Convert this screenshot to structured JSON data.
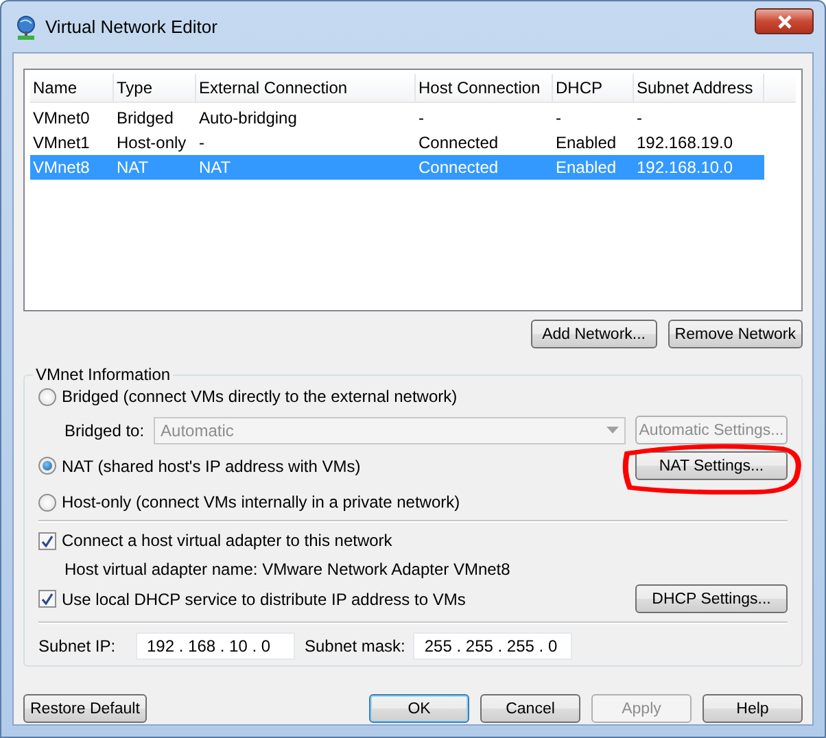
{
  "window": {
    "title": "Virtual Network Editor"
  },
  "table": {
    "columns": [
      "Name",
      "Type",
      "External Connection",
      "Host Connection",
      "DHCP",
      "Subnet Address"
    ],
    "rows": [
      {
        "cells": [
          "VMnet0",
          "Bridged",
          "Auto-bridging",
          "-",
          "-",
          "-"
        ],
        "selected": false
      },
      {
        "cells": [
          "VMnet1",
          "Host-only",
          "-",
          "Connected",
          "Enabled",
          "192.168.19.0"
        ],
        "selected": false
      },
      {
        "cells": [
          "VMnet8",
          "NAT",
          "NAT",
          "Connected",
          "Enabled",
          "192.168.10.0"
        ],
        "selected": true
      }
    ]
  },
  "table_buttons": [
    {
      "label": "Add Network..."
    },
    {
      "label": "Remove Network"
    }
  ],
  "vmnet_information": {
    "title": "VMnet Information",
    "bridged": {
      "label": "Bridged (connect VMs directly to the external network)",
      "selected": false
    },
    "bridged_to": {
      "label": "Bridged to:",
      "value": "Automatic",
      "disabled": true
    },
    "automatic_settings": {
      "label": "Automatic Settings...",
      "disabled": true
    },
    "nat": {
      "label": "NAT (shared host's IP address with VMs)",
      "selected": true
    },
    "nat_settings": {
      "label": "NAT Settings...",
      "highlighted": true
    },
    "host_only": {
      "label": "Host-only (connect VMs internally in a private network)",
      "selected": false
    },
    "connect_adapter": {
      "label": "Connect a host virtual adapter to this network",
      "checked": true
    },
    "adapter_name": "Host virtual adapter name: VMware Network Adapter VMnet8",
    "use_dhcp": {
      "label": "Use local DHCP service to distribute IP address to VMs",
      "checked": true
    },
    "dhcp_settings": {
      "label": "DHCP Settings..."
    },
    "subnet_ip": {
      "label": "Subnet IP:",
      "value": "192 . 168 . 10 . 0"
    },
    "subnet_mask": {
      "label": "Subnet mask:",
      "value": "255 . 255 . 255 . 0"
    }
  },
  "restore_default": {
    "label": "Restore Default"
  },
  "dialog_buttons": [
    {
      "label": "OK",
      "default": true,
      "disabled": false
    },
    {
      "label": "Cancel",
      "default": false,
      "disabled": false
    },
    {
      "label": "Apply",
      "default": false,
      "disabled": true
    },
    {
      "label": "Help",
      "default": false,
      "disabled": false
    }
  ]
}
